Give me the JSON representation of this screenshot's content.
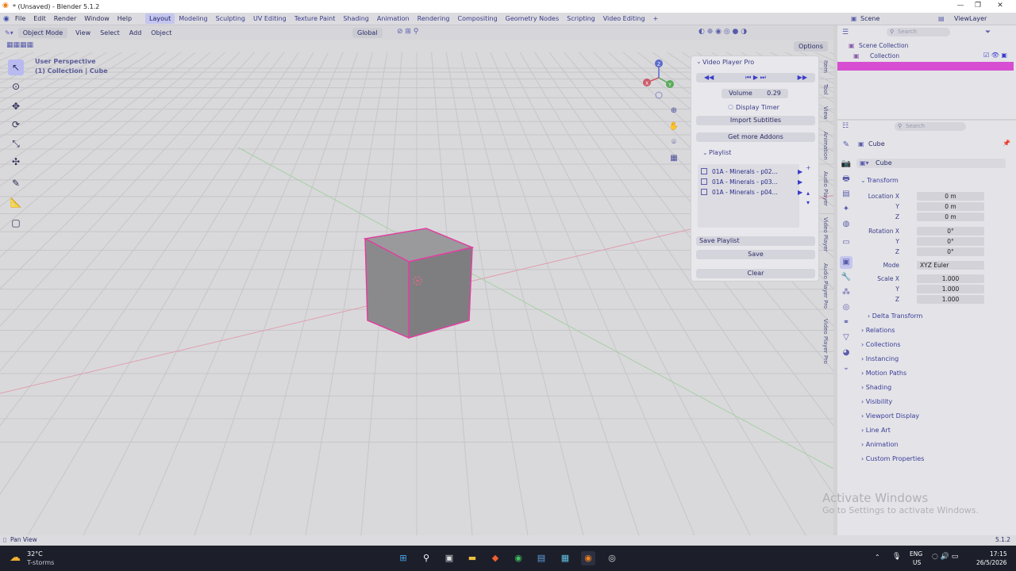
{
  "window": {
    "title": "* (Unsaved) - Blender 5.1.2",
    "minimize": "—",
    "maximize": "❐",
    "close": "✕"
  },
  "menu": [
    "File",
    "Edit",
    "Render",
    "Window",
    "Help"
  ],
  "workspaces": [
    "Layout",
    "Modeling",
    "Sculpting",
    "UV Editing",
    "Texture Paint",
    "Shading",
    "Animation",
    "Rendering",
    "Compositing",
    "Geometry Nodes",
    "Scripting",
    "Video Editing"
  ],
  "workspace_add": "+",
  "viewport_header": {
    "mode": "Object Mode",
    "view": "View",
    "select": "Select",
    "add": "Add",
    "object": "Object",
    "orientation": "Global",
    "options": "Options"
  },
  "viewport": {
    "perspective": "User Perspective",
    "collection_info": "(1) Collection | Cube"
  },
  "gizmo": {
    "z": "Z",
    "y": "Y",
    "x": "X"
  },
  "npanel": {
    "title": "Video Player Pro",
    "volume_label": "Volume",
    "volume_value": "0.29",
    "display_timer": "Display Timer",
    "import_subtitles": "Import Subtitles",
    "get_addons": "Get more Addons",
    "playlist_header": "Playlist",
    "playlist": [
      "01A - Minerals - p02...",
      "01A - Minerals - p03...",
      "01A - Minerals - p04..."
    ],
    "save_playlist": "Save Playlist",
    "save": "Save",
    "clear": "Clear"
  },
  "side_tabs": [
    "Item",
    "Tool",
    "View",
    "Animation",
    "Audio Player",
    "Video Player",
    "Audio Player Pro",
    "Video Player Pro"
  ],
  "outliner": {
    "scene": "Scene",
    "view_layer": "ViewLayer",
    "search_placeholder": "Search",
    "scene_collection": "Scene Collection",
    "collection": "Collection"
  },
  "properties": {
    "search_placeholder": "Search",
    "object_name": "Cube",
    "data_name": "Cube",
    "transform": "Transform",
    "location_x_label": "Location X",
    "location_x": "0 m",
    "location_y_label": "Y",
    "location_y": "0 m",
    "location_z_label": "Z",
    "location_z": "0 m",
    "rotation_x_label": "Rotation X",
    "rotation_x": "0°",
    "rotation_y_label": "Y",
    "rotation_y": "0°",
    "rotation_z_label": "Z",
    "rotation_z": "0°",
    "mode_label": "Mode",
    "mode": "XYZ Euler",
    "scale_x_label": "Scale X",
    "scale_x": "1.000",
    "scale_y_label": "Y",
    "scale_y": "1.000",
    "scale_z_label": "Z",
    "scale_z": "1.000",
    "delta_transform": "Delta Transform",
    "sections": [
      "Relations",
      "Collections",
      "Instancing",
      "Motion Paths",
      "Shading",
      "Visibility",
      "Viewport Display",
      "Line Art",
      "Animation",
      "Custom Properties"
    ]
  },
  "watermark": {
    "line1": "Activate Windows",
    "line2": "Go to Settings to activate Windows."
  },
  "status": {
    "left": "Pan View",
    "version": "5.1.2"
  },
  "taskbar": {
    "temp": "32°C",
    "weather": "T-storms",
    "lang": "ENG",
    "region": "US",
    "time": "17:15",
    "date": "26/5/2026"
  }
}
